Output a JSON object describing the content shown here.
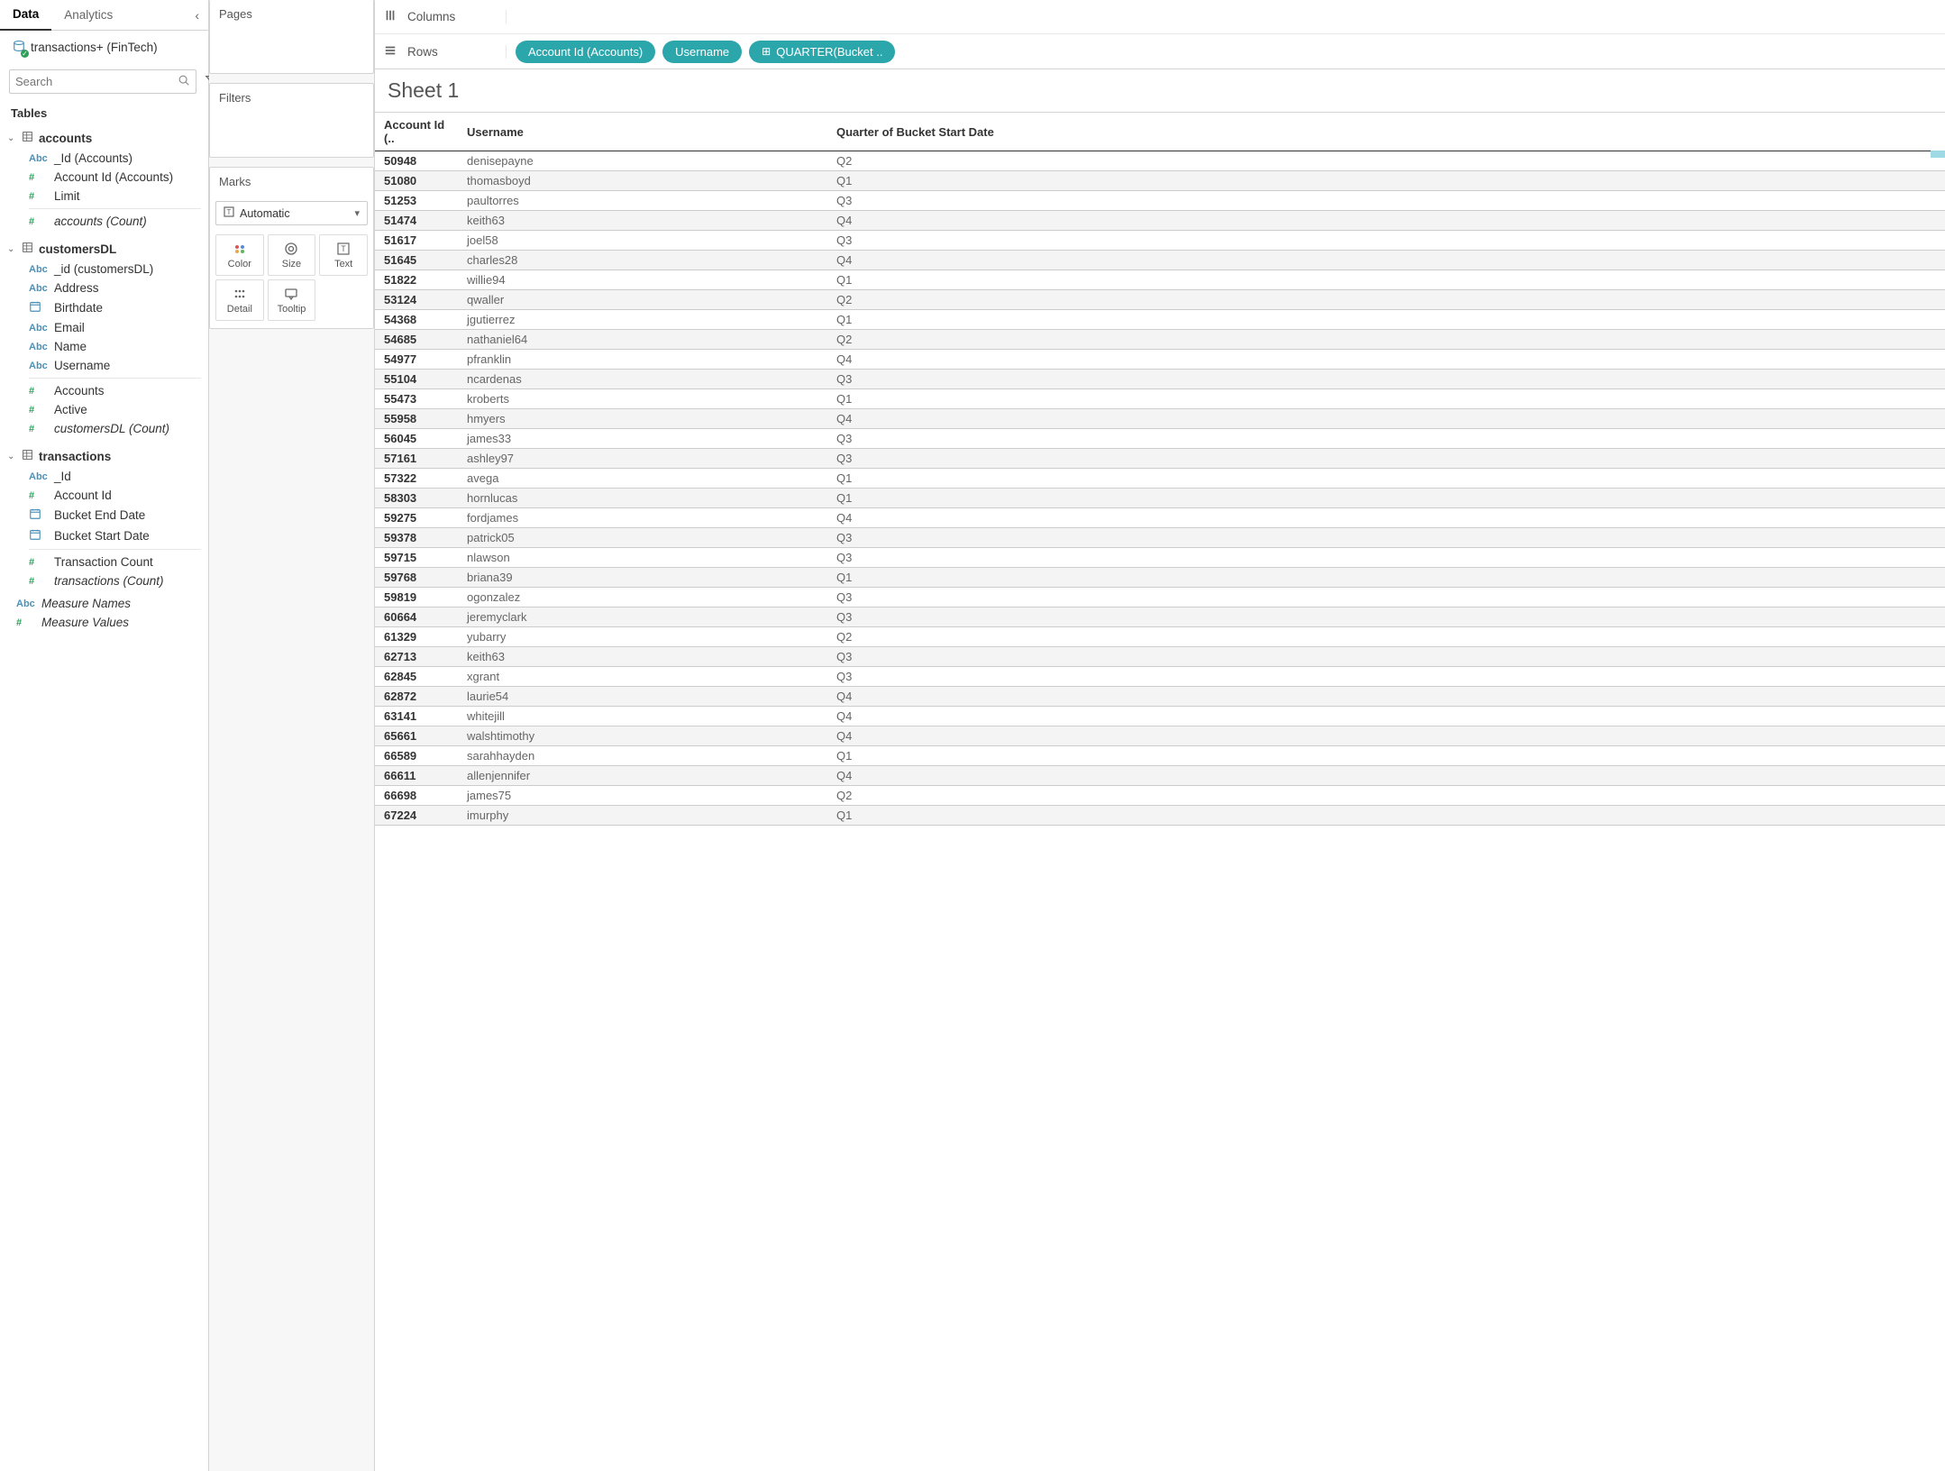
{
  "sidebar": {
    "tabs": {
      "data": "Data",
      "analytics": "Analytics"
    },
    "datasource": "transactions+ (FinTech)",
    "search_placeholder": "Search",
    "tables_header": "Tables",
    "tables": [
      {
        "name": "accounts",
        "fields": [
          {
            "type": "Abc",
            "type_class": "ft-string",
            "name": "_Id (Accounts)"
          },
          {
            "type": "#",
            "type_class": "ft-number",
            "name": "Account Id (Accounts)"
          },
          {
            "type": "#",
            "type_class": "ft-number",
            "name": "Limit"
          },
          {
            "type": "#",
            "type_class": "ft-number",
            "name": "accounts (Count)",
            "italic": true,
            "divider_before": true
          }
        ]
      },
      {
        "name": "customersDL",
        "fields": [
          {
            "type": "Abc",
            "type_class": "ft-string",
            "name": "_id (customersDL)"
          },
          {
            "type": "Abc",
            "type_class": "ft-string",
            "name": "Address"
          },
          {
            "type": "date",
            "type_class": "ft-date",
            "name": "Birthdate"
          },
          {
            "type": "Abc",
            "type_class": "ft-string",
            "name": "Email"
          },
          {
            "type": "Abc",
            "type_class": "ft-string",
            "name": "Name"
          },
          {
            "type": "Abc",
            "type_class": "ft-string",
            "name": "Username"
          },
          {
            "type": "#",
            "type_class": "ft-number",
            "name": "Accounts",
            "divider_before": true
          },
          {
            "type": "#",
            "type_class": "ft-number",
            "name": "Active"
          },
          {
            "type": "#",
            "type_class": "ft-number",
            "name": "customersDL (Count)",
            "italic": true
          }
        ]
      },
      {
        "name": "transactions",
        "fields": [
          {
            "type": "Abc",
            "type_class": "ft-string",
            "name": "_Id"
          },
          {
            "type": "#",
            "type_class": "ft-number",
            "name": "Account Id"
          },
          {
            "type": "date",
            "type_class": "ft-date",
            "name": "Bucket End Date"
          },
          {
            "type": "date",
            "type_class": "ft-date",
            "name": "Bucket Start Date"
          },
          {
            "type": "#",
            "type_class": "ft-number",
            "name": "Transaction Count",
            "divider_before": true
          },
          {
            "type": "#",
            "type_class": "ft-number",
            "name": "transactions (Count)",
            "italic": true
          }
        ]
      }
    ],
    "extras": [
      {
        "type": "Abc",
        "type_class": "ft-string",
        "name": "Measure Names",
        "italic": true
      },
      {
        "type": "#",
        "type_class": "ft-number",
        "name": "Measure Values",
        "italic": true
      }
    ]
  },
  "middle": {
    "pages": "Pages",
    "filters": "Filters",
    "marks": "Marks",
    "marks_dropdown": "Automatic",
    "marks_cells": [
      {
        "label": "Color",
        "icon": "color"
      },
      {
        "label": "Size",
        "icon": "size"
      },
      {
        "label": "Text",
        "icon": "text"
      },
      {
        "label": "Detail",
        "icon": "detail"
      },
      {
        "label": "Tooltip",
        "icon": "tooltip"
      }
    ]
  },
  "shelves": {
    "columns_label": "Columns",
    "rows_label": "Rows",
    "rows_pills": [
      {
        "label": "Account Id (Accounts)"
      },
      {
        "label": "Username"
      },
      {
        "label": "QUARTER(Bucket ..",
        "expand_icon": true
      }
    ]
  },
  "sheet": {
    "title": "Sheet 1",
    "columns": [
      {
        "key": "id",
        "label": "Account Id (.."
      },
      {
        "key": "user",
        "label": "Username"
      },
      {
        "key": "quarter",
        "label": "Quarter of Bucket Start Date"
      }
    ],
    "rows": [
      {
        "id": "50948",
        "user": "denisepayne",
        "quarter": "Q2"
      },
      {
        "id": "51080",
        "user": "thomasboyd",
        "quarter": "Q1"
      },
      {
        "id": "51253",
        "user": "paultorres",
        "quarter": "Q3"
      },
      {
        "id": "51474",
        "user": "keith63",
        "quarter": "Q4"
      },
      {
        "id": "51617",
        "user": "joel58",
        "quarter": "Q3"
      },
      {
        "id": "51645",
        "user": "charles28",
        "quarter": "Q4"
      },
      {
        "id": "51822",
        "user": "willie94",
        "quarter": "Q1"
      },
      {
        "id": "53124",
        "user": "qwaller",
        "quarter": "Q2"
      },
      {
        "id": "54368",
        "user": "jgutierrez",
        "quarter": "Q1"
      },
      {
        "id": "54685",
        "user": "nathaniel64",
        "quarter": "Q2"
      },
      {
        "id": "54977",
        "user": "pfranklin",
        "quarter": "Q4"
      },
      {
        "id": "55104",
        "user": "ncardenas",
        "quarter": "Q3"
      },
      {
        "id": "55473",
        "user": "kroberts",
        "quarter": "Q1"
      },
      {
        "id": "55958",
        "user": "hmyers",
        "quarter": "Q4"
      },
      {
        "id": "56045",
        "user": "james33",
        "quarter": "Q3"
      },
      {
        "id": "57161",
        "user": "ashley97",
        "quarter": "Q3"
      },
      {
        "id": "57322",
        "user": "avega",
        "quarter": "Q1"
      },
      {
        "id": "58303",
        "user": "hornlucas",
        "quarter": "Q1"
      },
      {
        "id": "59275",
        "user": "fordjames",
        "quarter": "Q4"
      },
      {
        "id": "59378",
        "user": "patrick05",
        "quarter": "Q3"
      },
      {
        "id": "59715",
        "user": "nlawson",
        "quarter": "Q3"
      },
      {
        "id": "59768",
        "user": "briana39",
        "quarter": "Q1"
      },
      {
        "id": "59819",
        "user": "ogonzalez",
        "quarter": "Q3"
      },
      {
        "id": "60664",
        "user": "jeremyclark",
        "quarter": "Q3"
      },
      {
        "id": "61329",
        "user": "yubarry",
        "quarter": "Q2"
      },
      {
        "id": "62713",
        "user": "keith63",
        "quarter": "Q3"
      },
      {
        "id": "62845",
        "user": "xgrant",
        "quarter": "Q3"
      },
      {
        "id": "62872",
        "user": "laurie54",
        "quarter": "Q4"
      },
      {
        "id": "63141",
        "user": "whitejill",
        "quarter": "Q4"
      },
      {
        "id": "65661",
        "user": "walshtimothy",
        "quarter": "Q4"
      },
      {
        "id": "66589",
        "user": "sarahhayden",
        "quarter": "Q1"
      },
      {
        "id": "66611",
        "user": "allenjennifer",
        "quarter": "Q4"
      },
      {
        "id": "66698",
        "user": "james75",
        "quarter": "Q2"
      },
      {
        "id": "67224",
        "user": "imurphy",
        "quarter": "Q1"
      }
    ]
  }
}
